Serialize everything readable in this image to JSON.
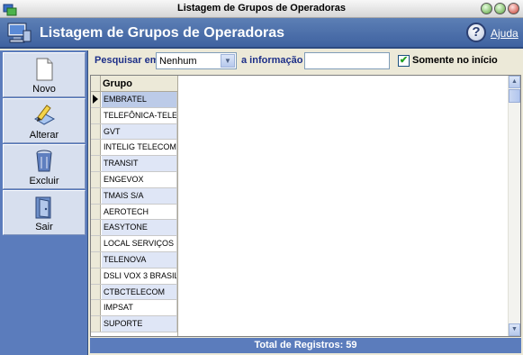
{
  "window": {
    "title": "Listagem de Grupos de Operadoras"
  },
  "header": {
    "title": "Listagem de Grupos de Operadoras",
    "help_label": "Ajuda"
  },
  "sidebar": {
    "buttons": [
      {
        "label": "Novo",
        "icon": "new-document-icon"
      },
      {
        "label": "Alterar",
        "icon": "edit-icon"
      },
      {
        "label": "Excluir",
        "icon": "trash-icon"
      },
      {
        "label": "Sair",
        "icon": "exit-door-icon"
      }
    ]
  },
  "search": {
    "label_search_in": "Pesquisar em",
    "field_value": "Nenhum",
    "label_information": "a informação",
    "input_value": "",
    "checkbox_label": "Somente no início",
    "checkbox_checked": true
  },
  "grid": {
    "column_header": "Grupo",
    "rows": [
      "EMBRATEL",
      "TELEFÔNICA-TELE",
      "GVT",
      "INTELIG TELECOM",
      "TRANSIT",
      "ENGEVOX",
      "TMAIS S/A",
      "AEROTECH",
      "EASYTONE",
      "LOCAL SERVIÇOS",
      "TELENOVA",
      "DSLI VOX 3 BRASIL",
      "CTBCTELECOM",
      "IMPSAT",
      "SUPORTE"
    ],
    "selected_index": 0
  },
  "footer": {
    "total": "Total de Registros: 59"
  },
  "colors": {
    "header_blue": "#4f70aa",
    "sidebar_blue": "#5b7cbc",
    "row_alt": "#dfe6f6"
  }
}
